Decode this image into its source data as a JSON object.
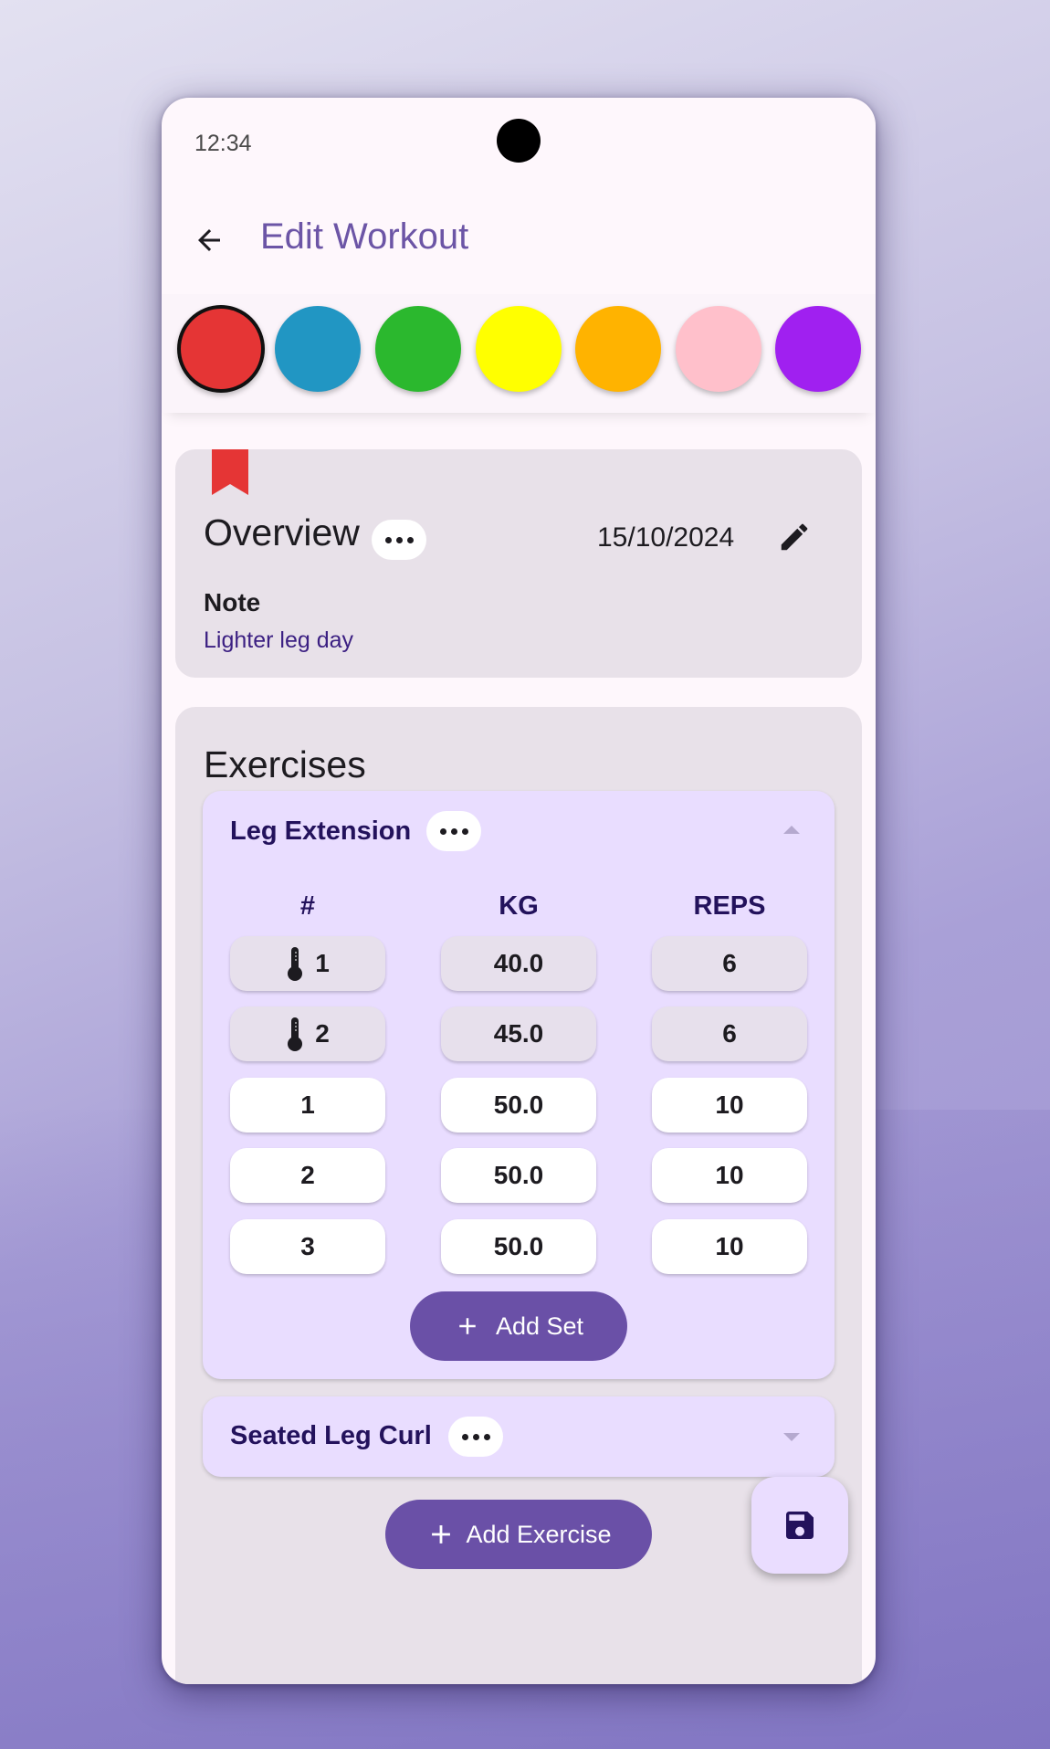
{
  "status_bar": {
    "time": "12:34"
  },
  "app_bar": {
    "title": "Edit Workout",
    "back_icon": "arrow-back-icon"
  },
  "color_picker": {
    "colors": [
      "#e53535",
      "#2196c3",
      "#2bb82e",
      "#ffff00",
      "#ffb300",
      "#ffc0cb",
      "#a020f0"
    ],
    "selected_index": 0
  },
  "overview": {
    "title": "Overview",
    "date": "15/10/2024",
    "note_label": "Note",
    "note_value": "Lighter leg day",
    "bookmark_color": "#e53535"
  },
  "exercises": {
    "title": "Exercises",
    "columns": [
      "#",
      "KG",
      "REPS"
    ],
    "items": [
      {
        "name": "Leg Extension",
        "expanded": true,
        "sets": [
          {
            "label": "1",
            "warmup": true,
            "kg": "40.0",
            "reps": "6"
          },
          {
            "label": "2",
            "warmup": true,
            "kg": "45.0",
            "reps": "6"
          },
          {
            "label": "1",
            "warmup": false,
            "kg": "50.0",
            "reps": "10"
          },
          {
            "label": "2",
            "warmup": false,
            "kg": "50.0",
            "reps": "10"
          },
          {
            "label": "3",
            "warmup": false,
            "kg": "50.0",
            "reps": "10"
          }
        ],
        "add_set_label": "Add Set"
      },
      {
        "name": "Seated Leg Curl",
        "expanded": false
      }
    ],
    "add_exercise_label": "Add Exercise"
  },
  "fab": {
    "icon": "save-icon"
  },
  "theme": {
    "accent": "#6a50a7",
    "title_color": "#6c55a6"
  }
}
